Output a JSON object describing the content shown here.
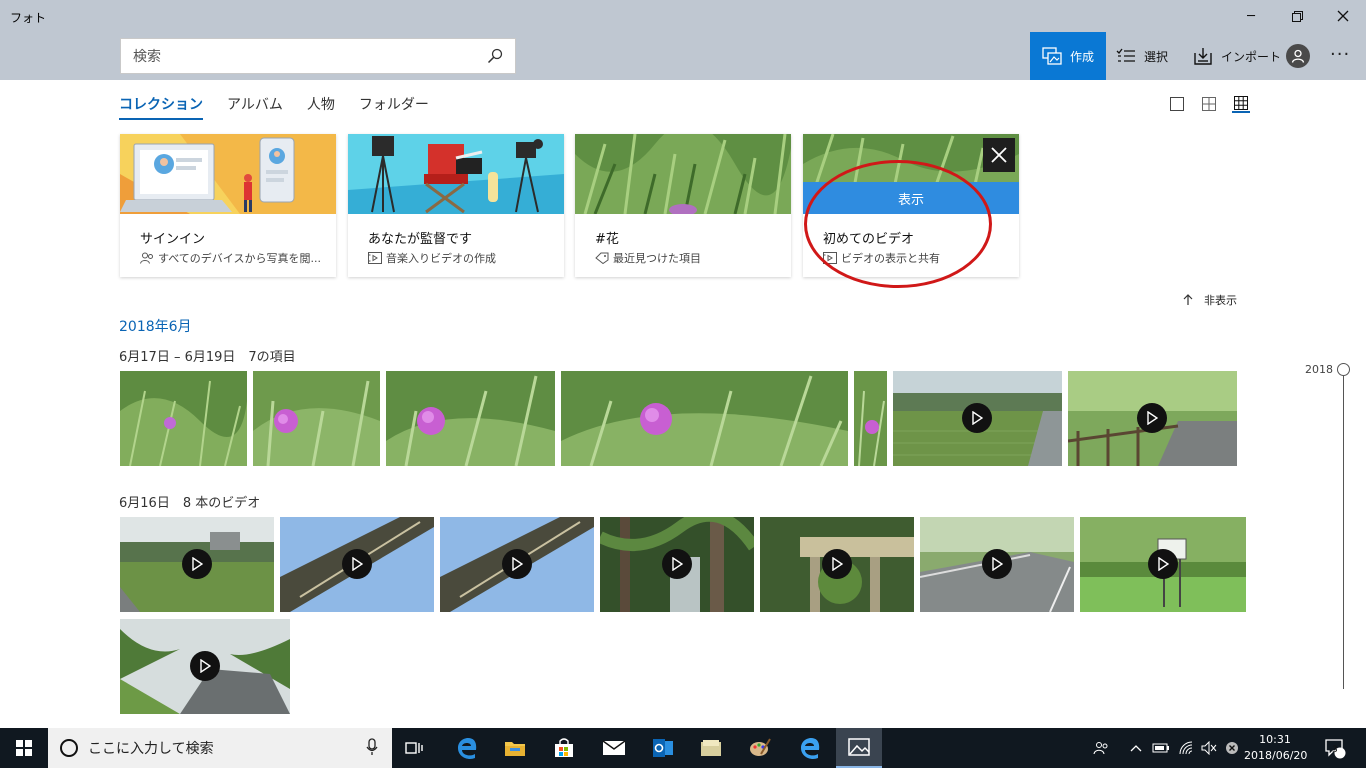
{
  "app": {
    "title": "フォト",
    "window_controls": [
      "minimize-icon",
      "restore-icon",
      "close-icon"
    ]
  },
  "search": {
    "placeholder": "検索"
  },
  "commands": {
    "create": "作成",
    "select": "選択",
    "import": "インポート"
  },
  "tabs": [
    {
      "label": "コレクション",
      "active": true
    },
    {
      "label": "アルバム",
      "active": false
    },
    {
      "label": "人物",
      "active": false
    },
    {
      "label": "フォルダー",
      "active": false
    }
  ],
  "cards": [
    {
      "title": "サインイン",
      "subtitle": "すべてのデバイスから写真を閲...",
      "icon": "people-icon"
    },
    {
      "title": "あなたが監督です",
      "subtitle": "音楽入りビデオの作成",
      "icon": "video-edit-icon"
    },
    {
      "title": "#花",
      "subtitle": "最近見つけた項目",
      "icon": "tag-icon"
    },
    {
      "title": "初めてのビデオ",
      "subtitle": "ビデオの表示と共有",
      "icon": "video-edit-icon",
      "show_button": "表示"
    }
  ],
  "hide_link": "非表示",
  "month_header": "2018年6月",
  "groups": [
    {
      "header": "6月17日 – 6月19日　7の項目"
    },
    {
      "header": "6月16日　8 本のビデオ"
    }
  ],
  "timeline": {
    "year": "2018"
  },
  "taskbar": {
    "search_placeholder": "ここに入力して検索",
    "time": "10:31",
    "date": "2018/06/20",
    "notifications": "3"
  },
  "colors": {
    "accent": "#0a78d4",
    "header_bg": "#bfc7d1",
    "taskbar_bg": "#101820",
    "annotation": "#d01818"
  }
}
